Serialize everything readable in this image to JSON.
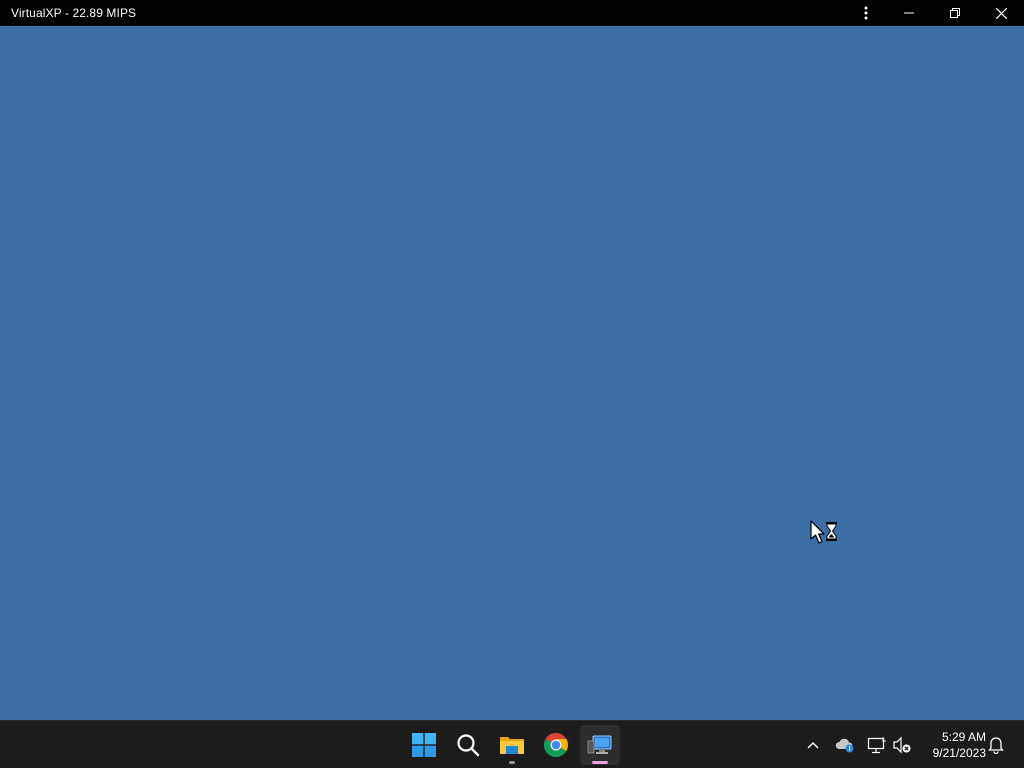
{
  "window": {
    "title": "VirtualXP - 22.89 MIPS"
  },
  "desktop": {
    "background_color": "#3a6ea5",
    "cursor": "busy-arrow-hourglass"
  },
  "taskbar": {
    "apps": [
      {
        "name": "start-button",
        "icon": "windows-logo-icon"
      },
      {
        "name": "search-button",
        "icon": "search-icon"
      },
      {
        "name": "file-explorer",
        "icon": "folder-icon"
      },
      {
        "name": "chrome",
        "icon": "chrome-icon"
      },
      {
        "name": "virtualxp",
        "icon": "virtual-pc-icon",
        "active": true
      }
    ],
    "tray": {
      "time": "5:29 AM",
      "date": "9/21/2023"
    }
  }
}
